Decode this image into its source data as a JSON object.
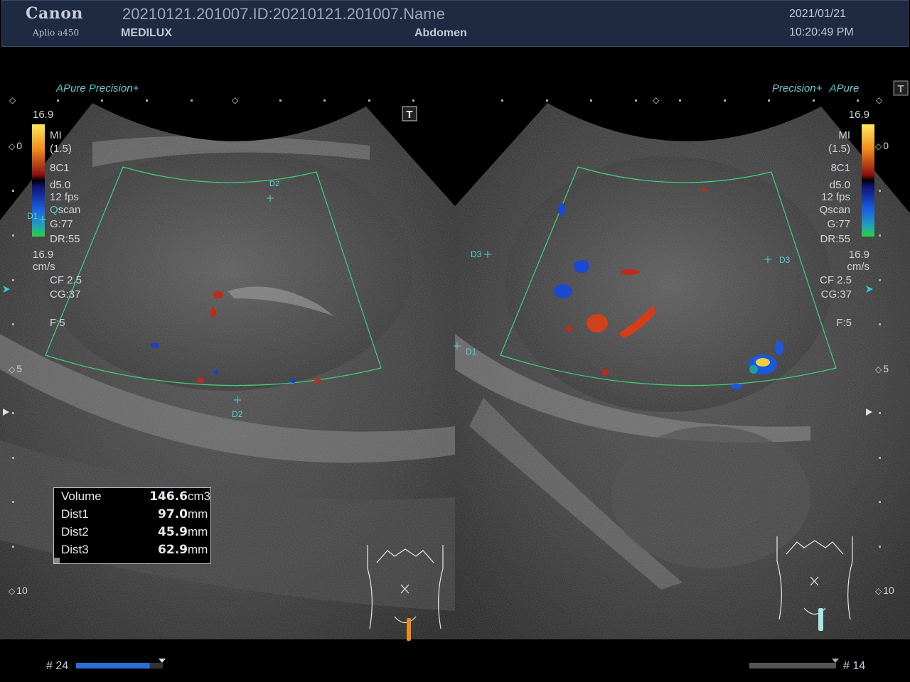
{
  "header": {
    "brand": "Canon",
    "model": "Aplio a450",
    "patient_id": "20210121.201007.ID:20210121.201007.Name",
    "institution": "MEDILUX",
    "exam_type": "Abdomen",
    "date": "2021/01/21",
    "time": "10:20:49 PM"
  },
  "left_panel": {
    "mode_a": "A",
    "mode_pure": "Pure",
    "mode_p": "P",
    "mode_precision": "recision",
    "scale_top": "16.9",
    "zero": "0",
    "mi": "MI",
    "mi_value": "(1.5)",
    "probe": "8C1",
    "depth_setting": "d5.0",
    "fps": "12 fps",
    "qscan": "scan",
    "qscan_q": "Q",
    "gain": "G:77",
    "dr": "DR:55",
    "velocity": "16.9",
    "velocity_unit": "cm/s",
    "cf": "CF 2.5",
    "cg": "CG:37",
    "focus": "F:5",
    "depth_5": "5",
    "depth_10": "10",
    "frame_label": "# 24",
    "frame_progress": 0.85
  },
  "right_panel": {
    "mode_precision": "Precision",
    "mode_a": "A",
    "mode_pure": "Pure",
    "scale_top": "16.9",
    "zero": "0",
    "mi": "MI",
    "mi_value": "(1.5)",
    "probe": "8C1",
    "depth_setting": "d5.0",
    "fps": "12 fps",
    "qscan": "Qscan",
    "gain": "G:77",
    "dr": "DR:55",
    "velocity": "16.9",
    "velocity_unit": "cm/s",
    "cf": "CF 2.5",
    "cg": "CG:37",
    "focus": "F:5",
    "depth_5": "5",
    "depth_10": "10",
    "frame_label": "# 14",
    "frame_progress": 1.0
  },
  "calipers": {
    "left": [
      "D1",
      "D2",
      "D2"
    ],
    "right": [
      "D3",
      "D3",
      "D1"
    ]
  },
  "measurements": [
    {
      "label": "Volume",
      "value": "146.6",
      "unit": "cm3"
    },
    {
      "label": "Dist1",
      "value": "97.0",
      "unit": "mm"
    },
    {
      "label": "Dist2",
      "value": "45.9",
      "unit": "mm"
    },
    {
      "label": "Dist3",
      "value": "62.9",
      "unit": "mm"
    }
  ],
  "colors": {
    "header_bg": "#1d2a41",
    "roi_box": "#3fd27a",
    "caliper": "#56d1d8",
    "left_probe_marker": "#f08a1c",
    "right_probe_marker": "#a8e6e0",
    "frame_bar": "#2a6fd0"
  },
  "icons": [
    "text-annotation-icon",
    "body-marker-icon",
    "scroll-arrow-icon",
    "focus-marker-icon"
  ]
}
